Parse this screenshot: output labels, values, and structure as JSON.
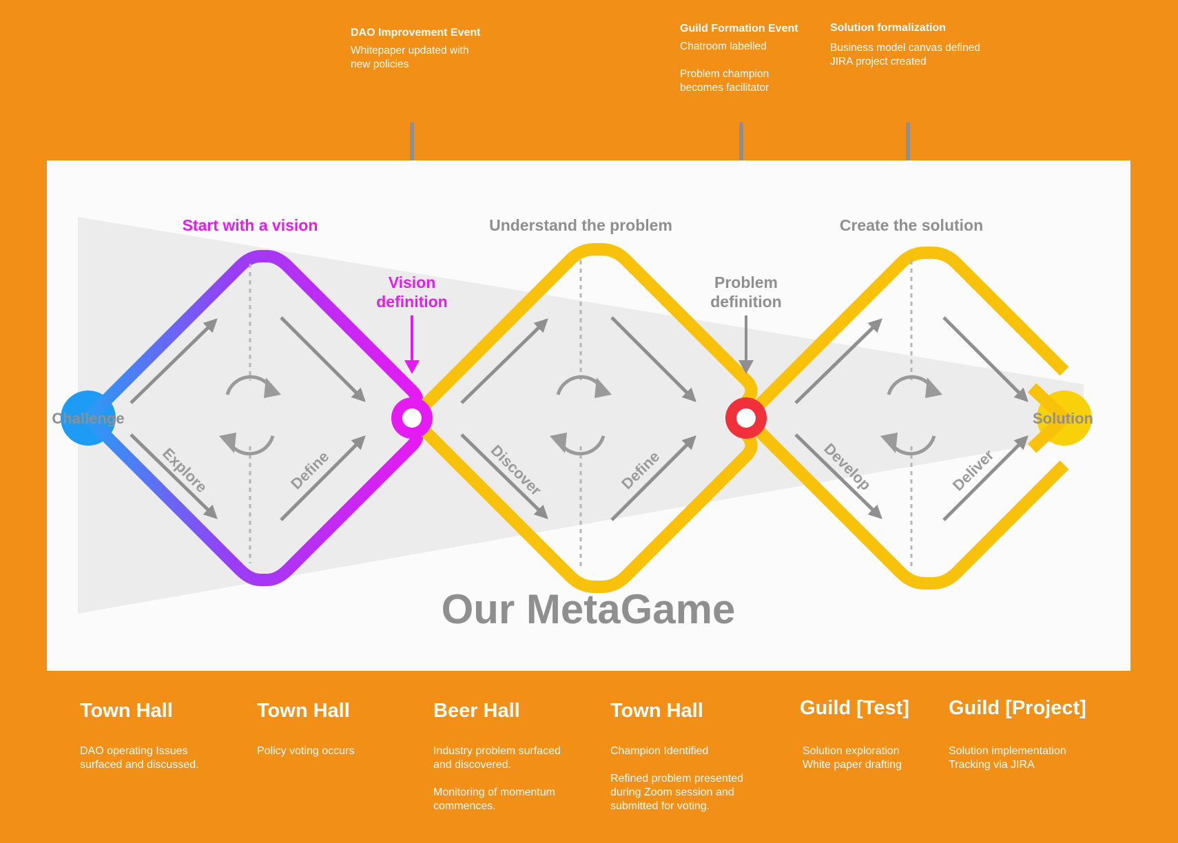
{
  "events": [
    {
      "title": "DAO Improvement Event",
      "lines": [
        "Whitepaper updated with",
        "new policies"
      ]
    },
    {
      "title": "Guild Formation Event",
      "lines": [
        "Chatroom labelled",
        "",
        "Problem champion",
        "becomes facilitator"
      ]
    },
    {
      "title": "Solution formalization",
      "lines": [
        "Business model canvas defined",
        "JIRA project created"
      ]
    }
  ],
  "diagram": {
    "phases": [
      "Start with a vision",
      "Understand the problem",
      "Create the solution"
    ],
    "start_label": "Challenge",
    "end_label": "Solution",
    "milestones": [
      {
        "line1": "Vision",
        "line2": "definition"
      },
      {
        "line1": "Problem",
        "line2": "definition"
      }
    ],
    "stage_labels": [
      "Explore",
      "Define",
      "Discover",
      "Define",
      "Develop",
      "Deliver"
    ],
    "title": "Our MetaGame",
    "colors": {
      "vision": "#E41BF2",
      "vision_gradient_start": "#2A9BF5",
      "problem_yellow": "#F9C20A",
      "problem_dot": "#F0303A",
      "grey": "#8f8f8f"
    }
  },
  "venues": [
    {
      "title": "Town Hall",
      "lines": [
        "DAO operating Issues",
        "surfaced and discussed."
      ]
    },
    {
      "title": "Town Hall",
      "lines": [
        "Policy voting occurs"
      ]
    },
    {
      "title": "Beer Hall",
      "lines": [
        "Industry problem surfaced",
        "and discovered.",
        "",
        "Monitoring of momentum",
        "commences."
      ]
    },
    {
      "title": "Town Hall",
      "lines": [
        "Champion Identified",
        "",
        "Refined problem presented",
        "during Zoom session and",
        "submitted for voting."
      ]
    },
    {
      "title": "Guild [Test]",
      "lines": [
        "Solution exploration",
        "White paper drafting"
      ]
    },
    {
      "title": "Guild [Project]",
      "lines": [
        "Solution implementation",
        "Tracking via JIRA"
      ]
    }
  ]
}
